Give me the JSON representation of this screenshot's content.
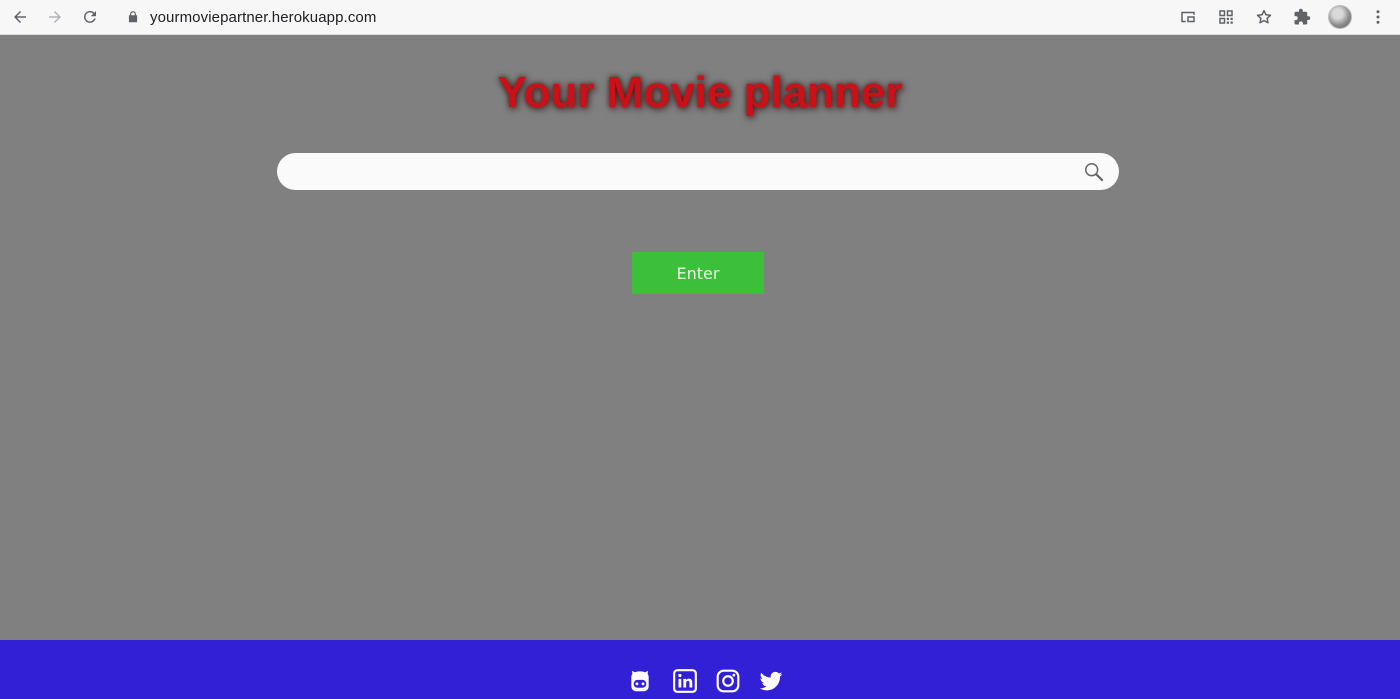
{
  "browser": {
    "url": "yourmoviepartner.herokuapp.com",
    "icons": [
      "back-icon",
      "forward-icon",
      "reload-icon",
      "lock-icon",
      "cast-icon",
      "qr-code-icon",
      "star-icon",
      "extensions-icon",
      "avatar"
    ]
  },
  "page": {
    "title": "Your Movie planner",
    "search": {
      "placeholder": "",
      "value": ""
    },
    "enter_label": "Enter"
  },
  "footer": {
    "links": [
      "github-icon",
      "linkedin-icon",
      "instagram-icon",
      "twitter-icon"
    ]
  },
  "colors": {
    "background": "#808080",
    "title": "#cc1018",
    "enter_button": "#3cc03c",
    "footer": "#3220d6"
  }
}
